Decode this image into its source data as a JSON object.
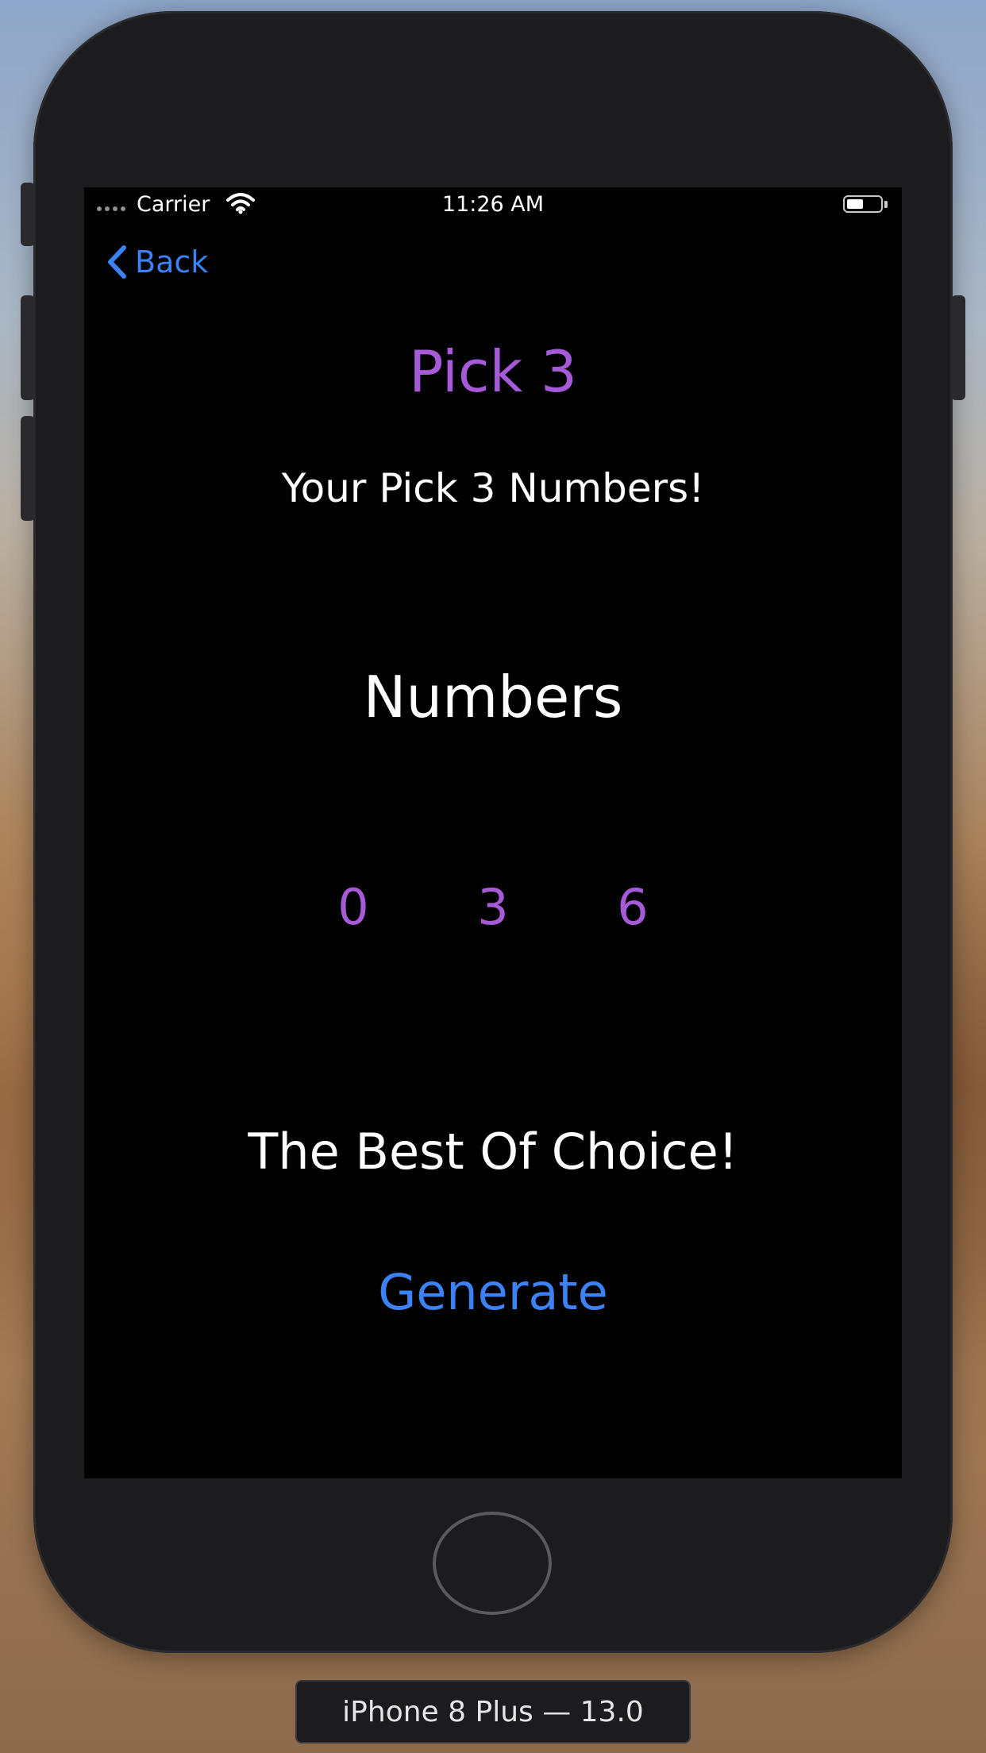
{
  "status_bar": {
    "carrier": "Carrier",
    "time": "11:26 AM",
    "icons": [
      "signal-dots-icon",
      "wifi-icon",
      "battery-icon"
    ]
  },
  "nav": {
    "back_label": "Back",
    "back_icon": "chevron-left-icon"
  },
  "main": {
    "title": "Pick 3",
    "subtitle": "Your Pick 3 Numbers!",
    "numbers_heading": "Numbers",
    "digits": [
      "0",
      "3",
      "6"
    ],
    "tagline": "The Best Of Choice!",
    "generate_label": "Generate"
  },
  "simulator": {
    "device_label": "iPhone 8 Plus — 13.0"
  },
  "colors": {
    "accent_purple": "#a75ad8",
    "link_blue": "#3b82f6",
    "screen_background": "#000000",
    "text_white": "#ffffff",
    "device_frame": "#1c1c1e"
  }
}
